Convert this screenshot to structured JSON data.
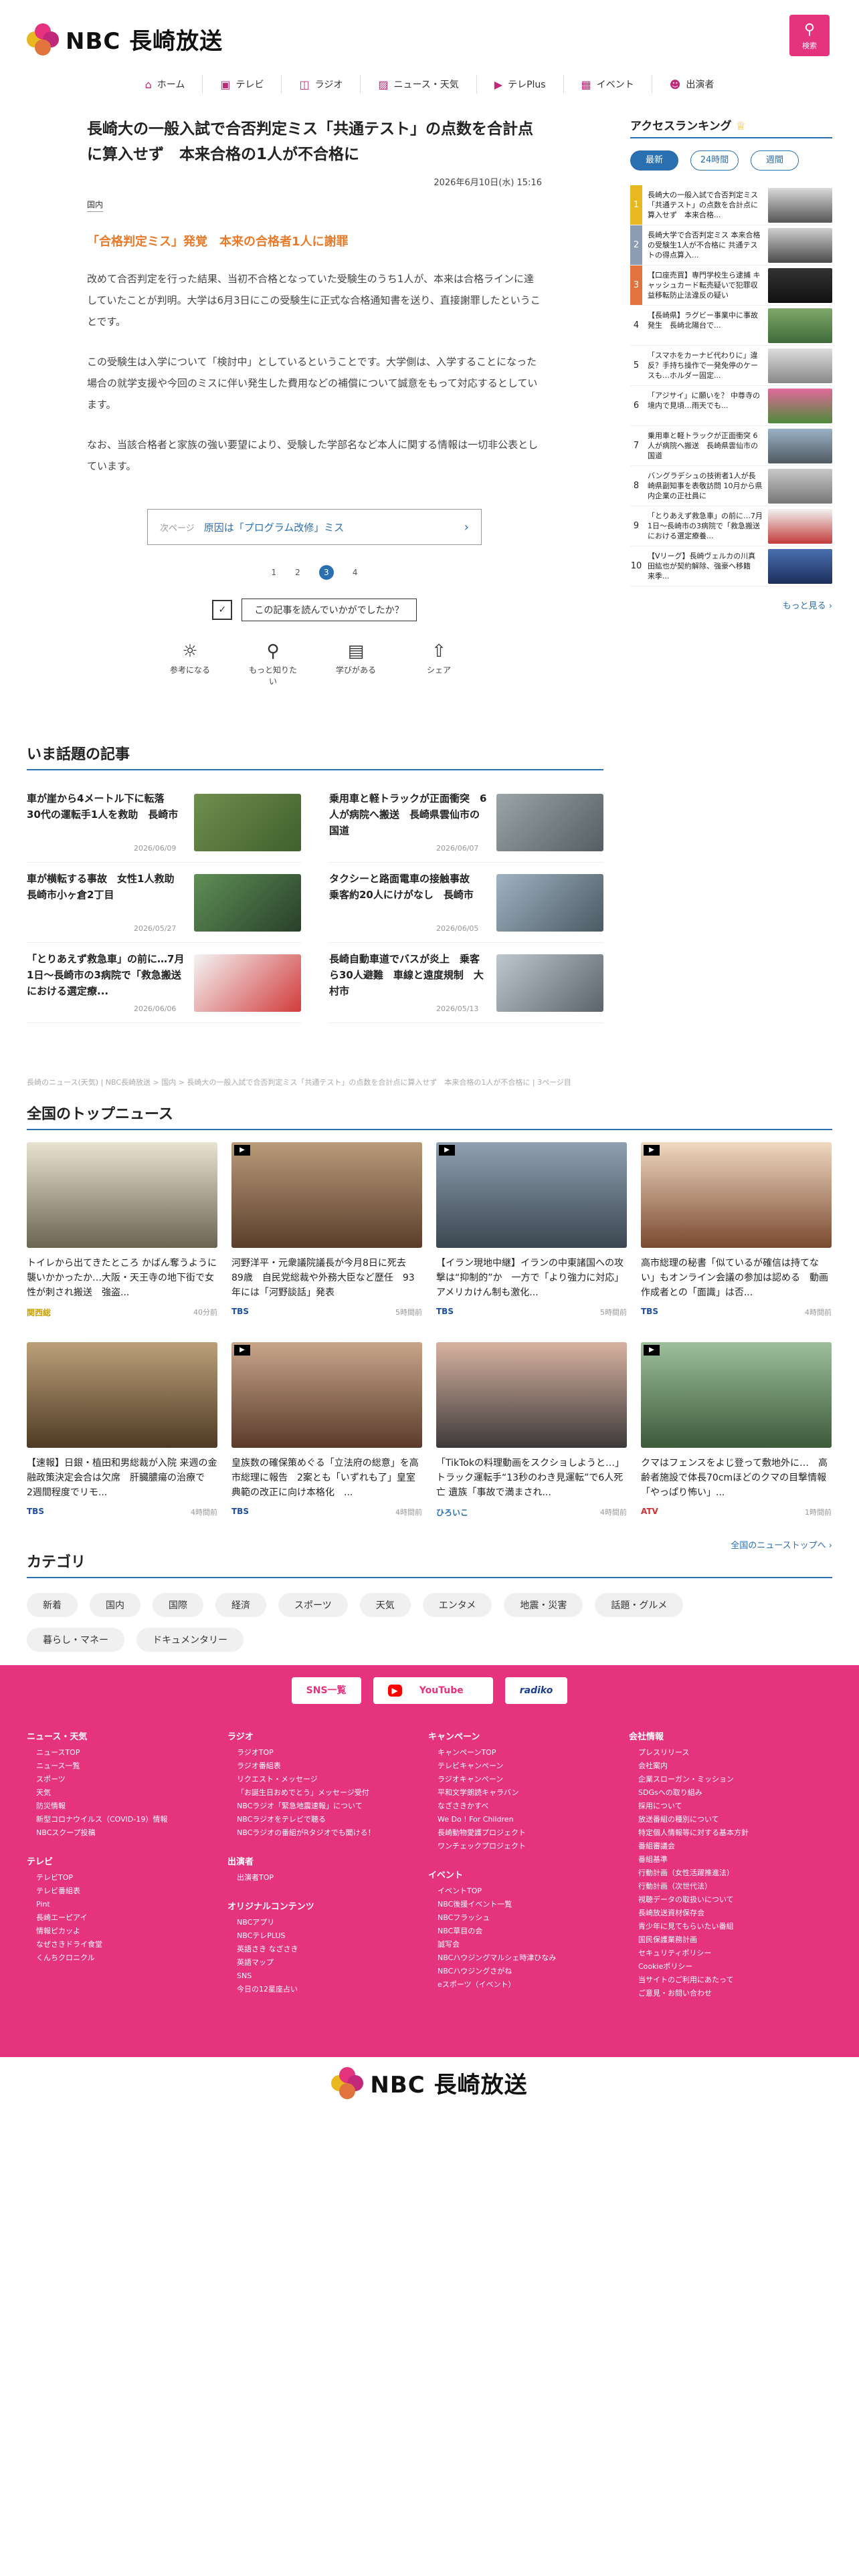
{
  "header": {
    "logo_text": "NBC 長崎放送",
    "search_label": "検索"
  },
  "nav": [
    {
      "label": "ホーム",
      "icon": "home-icon"
    },
    {
      "label": "テレビ",
      "icon": "tv-icon"
    },
    {
      "label": "ラジオ",
      "icon": "radio-icon"
    },
    {
      "label": "ニュース・天気",
      "icon": "news-icon"
    },
    {
      "label": "テレPlus",
      "icon": "teleplus-icon"
    },
    {
      "label": "イベント",
      "icon": "calendar-icon"
    },
    {
      "label": "出演者",
      "icon": "people-icon"
    }
  ],
  "article": {
    "title": "長崎大の一般入試で合否判定ミス「共通テスト」の点数を合計点に算入せず　本来合格の1人が不合格に",
    "date": "2026年6月10日(水) 15:16",
    "category": "国内",
    "lead": "「合格判定ミス」発覚　本来の合格者1人に謝罪",
    "paragraphs": [
      "改めて合否判定を行った結果、当初不合格となっていた受験生のうち1人が、本来は合格ラインに達していたことが判明。大学は6月3日にこの受験生に正式な合格通知書を送り、直接謝罪したということです。",
      "この受験生は入学について「検討中」としているということです。大学側は、入学することになった場合の就学支援や今回のミスに伴い発生した費用などの補償について誠意をもって対応するとしています。",
      "なお、当該合格者と家族の強い要望により、受験した学部名など本人に関する情報は一切非公表としています。"
    ],
    "next_label": "次ページ",
    "next_title": "原因は「プログラム改修」ミス",
    "pages": [
      "1",
      "2",
      "3",
      "4"
    ],
    "current_page": "3",
    "feedback_q": "この記事を読んでいかがでしたか？",
    "reactions": [
      "参考になる",
      "もっと知りたい",
      "学びがある",
      "シェア"
    ]
  },
  "ranking": {
    "title": "アクセスランキング",
    "tabs": [
      "最新",
      "24時間",
      "週間"
    ],
    "items": [
      {
        "num": "1",
        "text": "長崎大の一般入試で合否判定ミス「共通テスト」の点数を合計点に算入せず　本来合格..."
      },
      {
        "num": "2",
        "text": "長崎大学で合否判定ミス 本来合格の受験生1人が不合格に 共通テストの得点算入..."
      },
      {
        "num": "3",
        "text": "【口座売買】専門学校生ら逮捕 キャッシュカード転売疑いで犯罪収益移転防止法違反の疑い"
      },
      {
        "num": "4",
        "text": "【長崎県】ラグビー事業中に事故発生　長崎北陽台で..."
      },
      {
        "num": "5",
        "text": "「スマホをカーナビ代わりに」違反？手持ち操作で一発免停のケースも…ホルダー固定..."
      },
      {
        "num": "6",
        "text": "「アジサイ」に願いを？ 中尊寺の境内で見頃…雨天でも..."
      },
      {
        "num": "7",
        "text": "乗用車と軽トラックが正面衝突 6人が病院へ搬送　長崎県雲仙市の国道"
      },
      {
        "num": "8",
        "text": "バングラデシュの技術者1人が長崎県副知事を表敬訪問 10月から県内企業の正社員に"
      },
      {
        "num": "9",
        "text": "「とりあえず救急車」の前に…7月1日〜長崎市の3病院で「救急搬送における選定療養..."
      },
      {
        "num": "10",
        "text": "【Vリーグ】長崎ヴェルカの川真田紘也が契約解除、強豪へ移籍　来季..."
      }
    ],
    "more": "もっと見る"
  },
  "trending": {
    "title": "いま話題の記事",
    "items": [
      {
        "title": "車が崖から4メートル下に転落　30代の運転手1人を救助　長崎市",
        "date": "2026/06/09"
      },
      {
        "title": "乗用車と軽トラックが正面衝突　6人が病院へ搬送　長崎県雲仙市の国道",
        "date": "2026/06/07"
      },
      {
        "title": "車が横転する事故　女性1人救助　長崎市小ヶ倉2丁目",
        "date": "2026/05/27"
      },
      {
        "title": "タクシーと路面電車の接触事故　乗客約20人にけがなし　長崎市",
        "date": "2026/06/05"
      },
      {
        "title": "「とりあえず救急車」の前に…7月1日〜長崎市の3病院で「救急搬送における選定療...",
        "date": "2026/06/06"
      },
      {
        "title": "長崎自動車道でバスが炎上　乗客ら30人避難　車線と遠度規制　大村市",
        "date": "2026/05/13"
      }
    ]
  },
  "breadcrumb": "長崎のニュース(天気) | NBC長崎放送 > 国内 > 長崎大の一般入試で合否判定ミス「共通テスト」の点数を合計点に算入せず　本来合格の1人が不合格に | 3ページ目",
  "national": {
    "title": "全国のトップニュース",
    "items": [
      {
        "title": "トイレから出てきたところ かばん奪うように襲いかかったか…大阪・天王寺の地下街で女性が刺され搬送　強盗...",
        "src": "関西総",
        "time": "40分前",
        "srccolor": "#e8b820"
      },
      {
        "title": "河野洋平・元衆議院議長が今月8日に死去　89歳　自民党総裁や外務大臣など歴任　93年には「河野談話」発表",
        "src": "TBS",
        "time": "5時間前",
        "srccolor": "#1d4fa0"
      },
      {
        "title": "【イラン現地中継】イランの中東諸国への攻撃は“抑制的”か　一方で「より強力に対応」アメリカけん制も激化...",
        "src": "TBS",
        "time": "5時間前",
        "srccolor": "#1d4fa0"
      },
      {
        "title": "高市総理の秘書「似ているが確信は持てない」もオンライン会議の参加は認める　動画作成者との「面識」は否...",
        "src": "TBS",
        "time": "4時間前",
        "srccolor": "#1d4fa0"
      },
      {
        "title": "【速報】日銀・植田和男総裁が入院 来週の金融政策決定会合は欠席　肝臓膿瘍の治療で　2週間程度でリモ...",
        "src": "TBS",
        "time": "4時間前",
        "srccolor": "#1d4fa0"
      },
      {
        "title": "皇族数の確保策めぐる「立法府の総意」を高市総理に報告　2案とも「いずれも了」皇室典範の改正に向け本格化　...",
        "src": "TBS",
        "time": "4時間前",
        "srccolor": "#1d4fa0"
      },
      {
        "title": "「TikTokの料理動画をスクショしようと…」トラック運転手“13秒のわき見運転”で6人死亡 遺族「事故で満まされ...",
        "src": "ひろいこ",
        "time": "4時間前",
        "srccolor": "#2a6fb0"
      },
      {
        "title": "クマはフェンスをよじ登って敷地外に…　高齢者施設で体長70cmほどのクマの目撃情報　「やっぱり怖い」...",
        "src": "ATV",
        "time": "1時間前",
        "srccolor": "#d23030"
      }
    ],
    "more": "全国のニューストップへ"
  },
  "category": {
    "title": "カテゴリ",
    "chips": [
      "新着",
      "国内",
      "国際",
      "経済",
      "スポーツ",
      "天気",
      "エンタメ",
      "地震・災害",
      "話題・グルメ",
      "暮らし・マネー",
      "ドキュメンタリー"
    ]
  },
  "footer": {
    "sns": [
      "SNS一覧",
      "YouTube",
      "radiko"
    ],
    "col1": {
      "h1": "ニュース・天気",
      "l1": [
        "ニュースTOP",
        "ニュース一覧",
        "スポーツ",
        "天気",
        "防災情報",
        "新型コロナウイルス（COVID-19）情報",
        "NBCスクープ投稿"
      ],
      "h2": "テレビ",
      "l2": [
        "テレビTOP",
        "テレビ番組表",
        "Pint",
        "長崎エーピアイ",
        "情報ピカッよ",
        "なぜさきドライ食堂",
        "くんちクロニクル"
      ]
    },
    "col2": {
      "h1": "ラジオ",
      "l1": [
        "ラジオTOP",
        "ラジオ番組表",
        "リクエスト・メッセージ",
        "「お誕生日おめでとう」メッセージ受付",
        "NBCラジオ「緊急地震速報」について",
        "NBCラジオをテレビで聴る",
        "NBCラジオの番組がRタジオでも聞ける！"
      ],
      "h2": "出演者",
      "l2": [
        "出演者TOP"
      ],
      "h3": "オリジナルコンテンツ",
      "l3": [
        "NBCアプリ",
        "NBCテレPLUS",
        "英語さき なざさき",
        "英語マップ",
        "SNS",
        "今日の12星座占い"
      ]
    },
    "col3": {
      "h1": "キャンペーン",
      "l1": [
        "キャンペーンTOP",
        "テレビキャンペーン",
        "ラジオキャンペーン",
        "平和文学朗読キャラバン",
        "なざさきかすべ",
        "We Do ! For Children",
        "長崎動物愛護プロジェクト",
        "ワンチェックプロジェクト"
      ],
      "h2": "イベント",
      "l2": [
        "イベントTOP",
        "NBC後援イベント一覧",
        "NBCフラッシュ",
        "NBC草目の会",
        "誠写会",
        "NBCハウジングマルシェ時津ひなみ",
        "NBCハウジングさがね",
        "eスポーツ（イベント）"
      ]
    },
    "col4": {
      "h1": "会社情報",
      "l1": [
        "プレスリリース",
        "会社案内",
        "企業スローガン・ミッション",
        "SDGsへの取り組み",
        "採用について",
        "放送番組の種別について",
        "特定個人情報等に対する基本方針",
        "番組審議会",
        "番組基準",
        "行動計画（女性活躍推進法）",
        "行動計画（次世代法）",
        "視聴データの取扱いについて",
        "長崎放送資材保存会",
        "青少年に見てもらいたい番組",
        "国民保護業務計画",
        "セキュリティポリシー",
        "Cookieポリシー",
        "当サイトのご利用にあたって",
        "ご意見・お問い合わせ"
      ]
    }
  },
  "colors": {
    "brand": "#e5337e",
    "accent": "#2a6fb0",
    "lead": "#e87b2b"
  }
}
